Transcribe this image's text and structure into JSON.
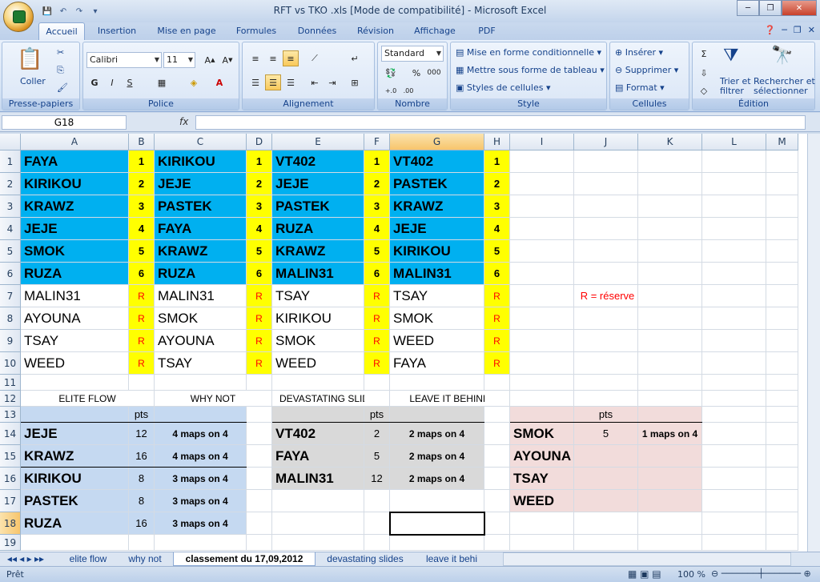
{
  "window": {
    "title": "RFT vs TKO .xls  [Mode de compatibilité] - Microsoft Excel",
    "minimize": "─",
    "restore": "❐",
    "close": "✕"
  },
  "tabs": [
    "Accueil",
    "Insertion",
    "Mise en page",
    "Formules",
    "Données",
    "Révision",
    "Affichage",
    "PDF"
  ],
  "ribbon": {
    "clipboard": {
      "name": "Presse-papiers",
      "paste": "Coller"
    },
    "font": {
      "name": "Police",
      "family": "Calibri",
      "size": "11",
      "bold": "G",
      "italic": "I",
      "underline": "S"
    },
    "alignment": {
      "name": "Alignement"
    },
    "number": {
      "name": "Nombre",
      "format": "Standard",
      "percent": "%",
      "thousands": "000"
    },
    "style": {
      "name": "Style",
      "conditional": "Mise en forme conditionnelle",
      "as_table": "Mettre sous forme de tableau",
      "cell_styles": "Styles de cellules"
    },
    "cells": {
      "name": "Cellules",
      "insert": "Insérer",
      "delete": "Supprimer",
      "format": "Format"
    },
    "editing": {
      "name": "Édition",
      "sort_1": "Trier et",
      "sort_2": "filtrer",
      "find_1": "Rechercher et",
      "find_2": "sélectionner"
    }
  },
  "formula_bar": {
    "name_box": "G18",
    "fx": "fx",
    "value": ""
  },
  "columns": [
    "A",
    "B",
    "C",
    "D",
    "E",
    "F",
    "G",
    "H",
    "I",
    "J",
    "K",
    "L",
    "M"
  ],
  "rows": [
    "1",
    "2",
    "3",
    "4",
    "5",
    "6",
    "7",
    "8",
    "9",
    "10",
    "11",
    "12",
    "13",
    "14",
    "15",
    "16",
    "17",
    "18",
    "19"
  ],
  "cells": {
    "A1": "FAYA",
    "B1": "1",
    "C1": "KIRIKOU",
    "D1": "1",
    "E1": "VT402",
    "F1": "1",
    "G1": "VT402",
    "H1": "1",
    "A2": "KIRIKOU",
    "B2": "2",
    "C2": "JEJE",
    "D2": "2",
    "E2": "JEJE",
    "F2": "2",
    "G2": "PASTEK",
    "H2": "2",
    "A3": "KRAWZ",
    "B3": "3",
    "C3": "PASTEK",
    "D3": "3",
    "E3": "PASTEK",
    "F3": "3",
    "G3": "KRAWZ",
    "H3": "3",
    "A4": "JEJE",
    "B4": "4",
    "C4": "FAYA",
    "D4": "4",
    "E4": "RUZA",
    "F4": "4",
    "G4": "JEJE",
    "H4": "4",
    "A5": "SMOK",
    "B5": "5",
    "C5": "KRAWZ",
    "D5": "5",
    "E5": "KRAWZ",
    "F5": "5",
    "G5": "KIRIKOU",
    "H5": "5",
    "A6": "RUZA",
    "B6": "6",
    "C6": "RUZA",
    "D6": "6",
    "E6": "MALIN31",
    "F6": "6",
    "G6": "MALIN31",
    "H6": "6",
    "A7": "MALIN31",
    "B7": "R",
    "C7": "MALIN31",
    "D7": "R",
    "E7": "TSAY",
    "F7": "R",
    "G7": "TSAY",
    "H7": "R",
    "J7": "R = réserve",
    "A8": "AYOUNA",
    "B8": "R",
    "C8": "SMOK",
    "D8": "R",
    "E8": "KIRIKOU",
    "F8": "R",
    "G8": "SMOK",
    "H8": "R",
    "A9": "TSAY",
    "B9": "R",
    "C9": "AYOUNA",
    "D9": "R",
    "E9": "SMOK",
    "F9": "R",
    "G9": "WEED",
    "H9": "R",
    "A10": "WEED",
    "B10": "R",
    "C10": "TSAY",
    "D10": "R",
    "E10": "WEED",
    "F10": "R",
    "G10": "FAYA",
    "H10": "R",
    "A12": "ELITE FLOW",
    "C12": "WHY NOT",
    "E12": "DEVASTATING SLIDES",
    "G12": "LEAVE IT BEHIND",
    "B13": "pts",
    "F13": "pts",
    "J13": "pts",
    "A14": "JEJE",
    "B14": "12",
    "C14": "4 maps on 4",
    "E14": "VT402",
    "F14": "2",
    "G14": "2 maps on 4",
    "I14": "SMOK",
    "J14": "5",
    "K14": "1 maps on 4",
    "A15": "KRAWZ",
    "B15": "16",
    "C15": "4 maps on 4",
    "E15": "FAYA",
    "F15": "5",
    "G15": "2 maps on 4",
    "I15": "AYOUNA",
    "A16": "KIRIKOU",
    "B16": "8",
    "C16": "3 maps on 4",
    "E16": "MALIN31",
    "F16": "12",
    "G16": "2 maps on 4",
    "I16": "TSAY",
    "A17": "PASTEK",
    "B17": "8",
    "C17": "3 maps on 4",
    "I17": "WEED",
    "A18": "RUZA",
    "B18": "16",
    "C18": "3 maps on 4"
  },
  "sheets": [
    "elite flow",
    "why not",
    "classement du 17,09,2012",
    "devastating slides",
    "leave it behi"
  ],
  "status": {
    "ready": "Prêt",
    "zoom": "100 %"
  },
  "colors": {
    "blue_fill": "#00b0f0",
    "yellow": "#ffff00",
    "light_blue": "#c5d9f1",
    "gray": "#d9d9d9",
    "pink": "#f2dcdb",
    "reserve_red": "#ff0000"
  }
}
